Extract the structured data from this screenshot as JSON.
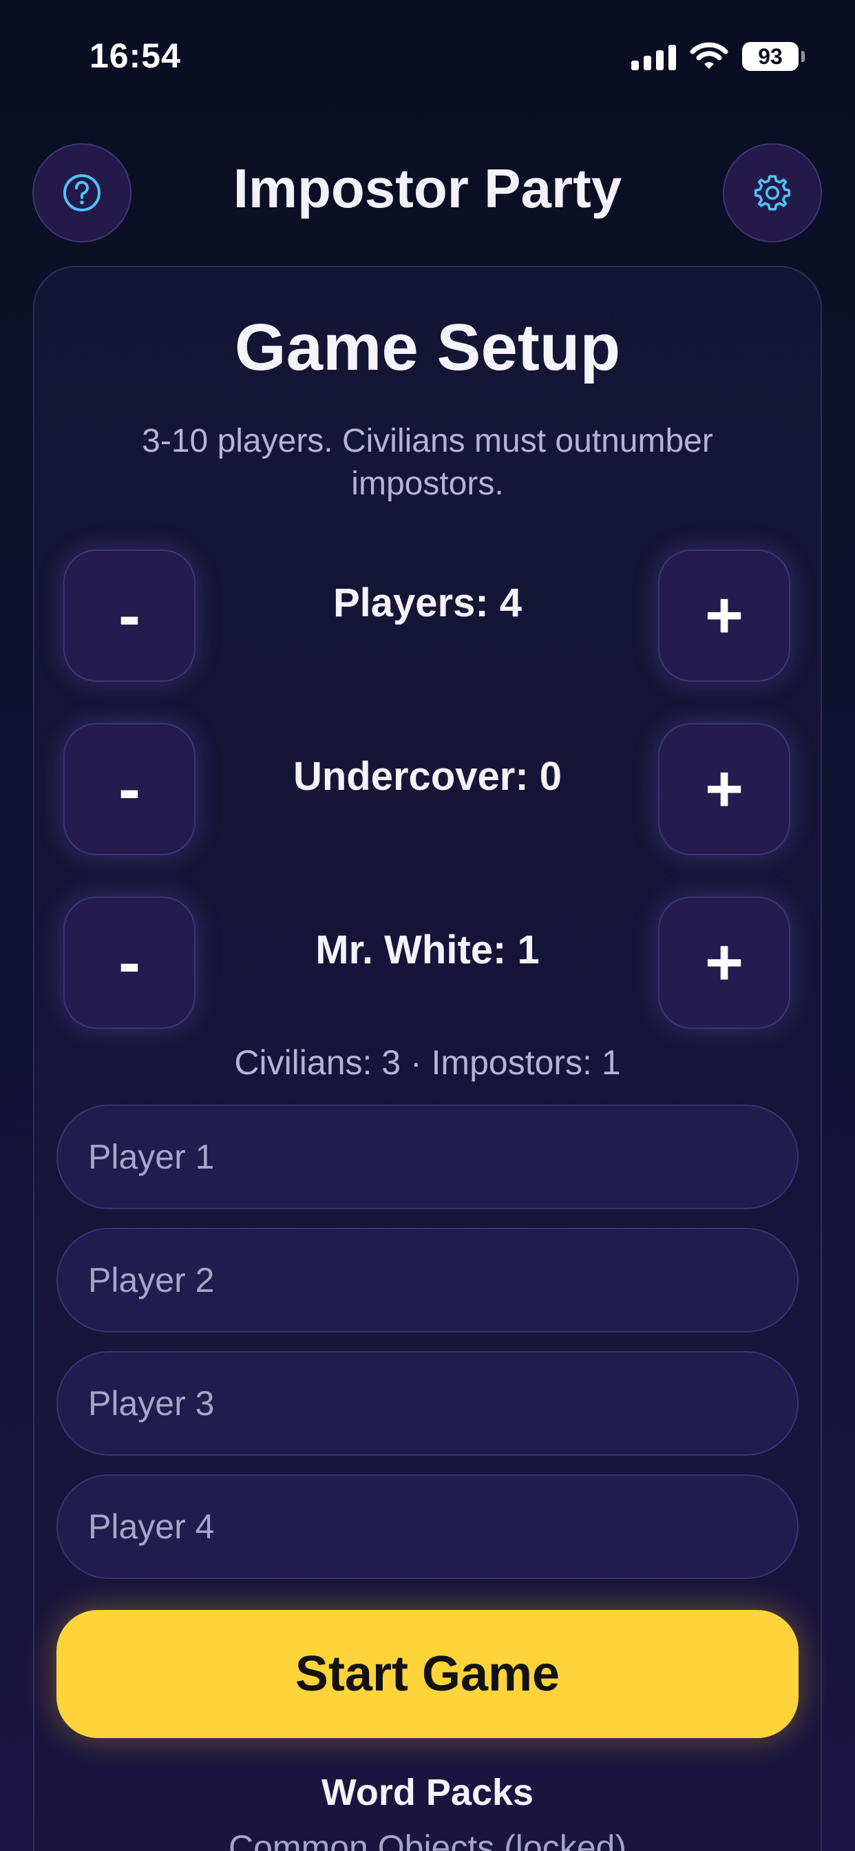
{
  "status_bar": {
    "time": "16:54",
    "battery": "93",
    "icons": [
      "cellular-signal-icon",
      "wifi-icon",
      "battery-icon"
    ]
  },
  "header": {
    "title": "Impostor Party",
    "help_icon": "question-circle-icon",
    "settings_icon": "gear-icon",
    "accent_color": "#4fc3f7"
  },
  "setup": {
    "title": "Game Setup",
    "subtitle": "3-10 players. Civilians must outnumber impostors.",
    "steppers": [
      {
        "label": "Players: 4",
        "minus": "-",
        "plus": "+"
      },
      {
        "label": "Undercover: 0",
        "minus": "-",
        "plus": "+"
      },
      {
        "label": "Mr. White: 1",
        "minus": "-",
        "plus": "+"
      }
    ],
    "summary": "Civilians: 3 · Impostors: 1",
    "player_inputs": [
      {
        "placeholder": "Player 1",
        "value": ""
      },
      {
        "placeholder": "Player 2",
        "value": ""
      },
      {
        "placeholder": "Player 3",
        "value": ""
      },
      {
        "placeholder": "Player 4",
        "value": ""
      }
    ],
    "start_button": "Start Game",
    "start_color": "#ffd43a"
  },
  "word_packs": {
    "title": "Word Packs",
    "items": [
      "Common Objects (locked)"
    ]
  }
}
